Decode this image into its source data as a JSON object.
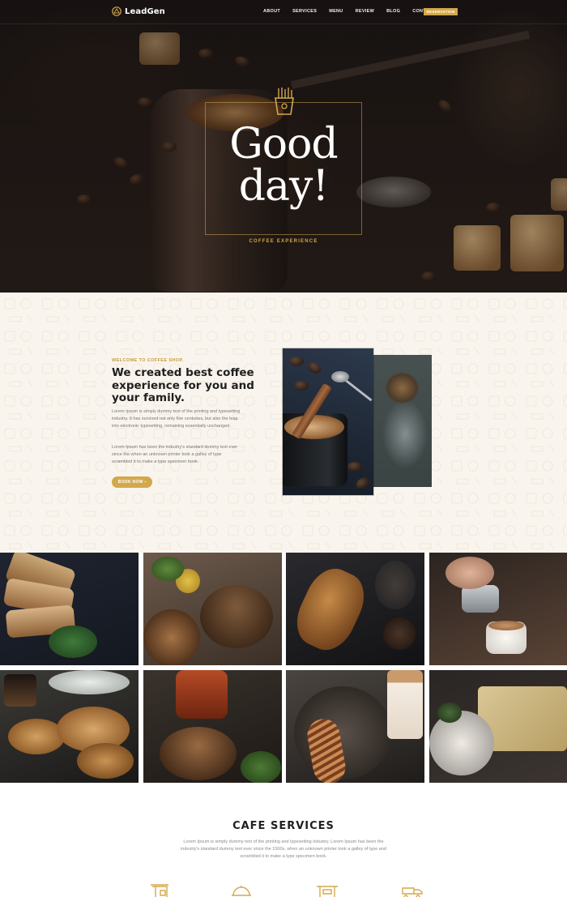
{
  "brand": {
    "name": "LeadGen",
    "accent_color": "#d4a84a"
  },
  "nav": {
    "links": [
      "ABOUT",
      "SERVICES",
      "MENU",
      "REVIEW",
      "BLOG",
      "CONTACT"
    ],
    "reservation_label": "RESERVATION"
  },
  "hero": {
    "title_line1": "Good",
    "title_line2": "day!",
    "subtitle": "COFFEE EXPERIENCE",
    "icon": "fries-icon"
  },
  "welcome": {
    "eyebrow": "WELCOME TO COFFEE SHOP.",
    "title": "We created best coffee experience for you and your family.",
    "paragraph1": "Lorem Ipsum is simply dummy text of the printing and typesetting industry. It has survived not only five centuries, but also the leap into electronic typesetting, remaining essentially unchanged.",
    "paragraph2": "Lorem Ipsum has been the industry's standard dummy text ever since the when an unknown printer took a galley of type scrambled it to make a type specimen book.",
    "button_label": "BOOK NOW ›"
  },
  "gallery": {
    "tiles": [
      "toast-bread",
      "bread-loaves",
      "croissant",
      "latte-art",
      "croissants",
      "burger-and-sauce",
      "eclair-and-latte",
      "crackers"
    ]
  },
  "services": {
    "title": "CAFE SERVICES",
    "description": "Lorem Ipsum is simply dummy text of the printing and typesetting industry. Lorem Ipsum has been the industry's standard dummy text ever since the 1500s, when an unknown printer took a galley of type and scrambled it to make a type specimen book.",
    "icons": [
      "coffee-machine-icon",
      "cloche-icon",
      "mixer-icon",
      "delivery-icon"
    ]
  }
}
